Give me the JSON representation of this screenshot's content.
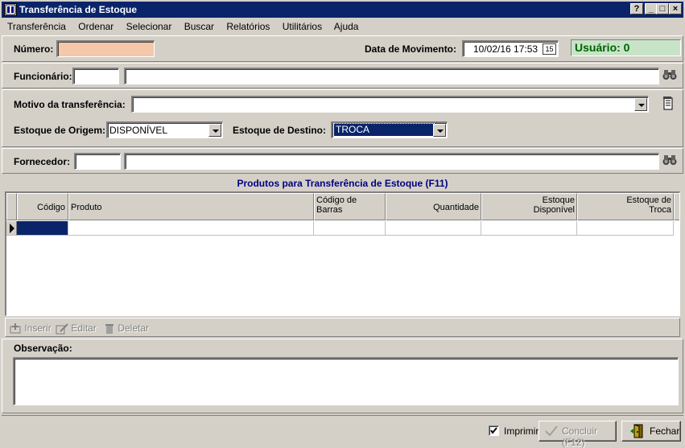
{
  "window": {
    "title": "Transferência de Estoque",
    "controls": {
      "help": "?",
      "minimize": "_",
      "maximize": "□",
      "close": "×"
    }
  },
  "menu": [
    "Transferência",
    "Ordenar",
    "Selecionar",
    "Buscar",
    "Relatórios",
    "Utilitários",
    "Ajuda"
  ],
  "header": {
    "numero_label": "Número:",
    "numero_value": "",
    "data_label": "Data de Movimento:",
    "data_value": "10/02/16 17:53",
    "calendar_text": "15",
    "usuario": "Usuário: 0"
  },
  "funcionario": {
    "label": "Funcionário:",
    "code": "",
    "name": ""
  },
  "motivo": {
    "label": "Motivo da transferência:",
    "value": ""
  },
  "estoque": {
    "origem_label": "Estoque de Origem:",
    "origem_value": "DISPONÍVEL",
    "destino_label": "Estoque de Destino:",
    "destino_value": "TROCA"
  },
  "fornecedor": {
    "label": "Fornecedor:",
    "code": "",
    "name": ""
  },
  "products": {
    "title": "Produtos para Transferência de Estoque (F11)",
    "columns": [
      "Código",
      "Produto",
      "Código de\nBarras",
      "Quantidade",
      "Estoque\nDisponível",
      "Estoque de\nTroca"
    ]
  },
  "toolbar": {
    "insert": "Inserir",
    "edit": "Editar",
    "delete": "Deletar"
  },
  "observacao": {
    "label": "Observação:",
    "value": ""
  },
  "footer": {
    "print_label": "Imprimir",
    "print_checked": true,
    "conclude": "Concluir (F12)",
    "close": "Fechar"
  },
  "colors": {
    "title_bg": "#0a246a",
    "numero_bg": "#f4c8a8",
    "usuario_bg": "#c8e4c8",
    "usuario_fg": "#006000",
    "grid_title": "#000080"
  }
}
